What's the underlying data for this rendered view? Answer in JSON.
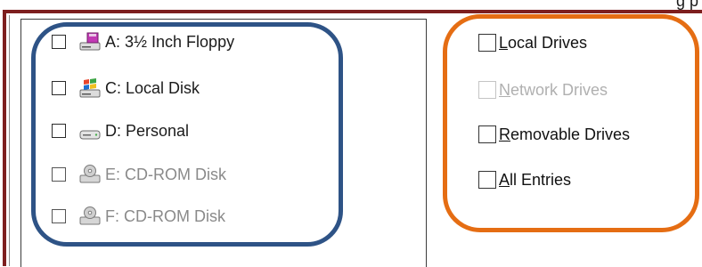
{
  "header": {
    "clipped_text": "g p"
  },
  "drive_list": {
    "items": [
      {
        "label": "A: 3½ Inch Floppy",
        "icon": "floppy-drive-icon",
        "checked": false,
        "enabled": true
      },
      {
        "label": "C: Local Disk",
        "icon": "windows-local-disk-icon",
        "checked": false,
        "enabled": true
      },
      {
        "label": "D: Personal",
        "icon": "hard-drive-icon",
        "checked": false,
        "enabled": true
      },
      {
        "label": "E: CD-ROM Disk",
        "icon": "cd-rom-drive-icon",
        "checked": false,
        "enabled": false
      },
      {
        "label": "F: CD-ROM Disk",
        "icon": "cd-rom-drive-icon",
        "checked": false,
        "enabled": false
      }
    ]
  },
  "options": {
    "local_drives": {
      "mnemonic": "L",
      "rest": "ocal Drives",
      "checked": false,
      "enabled": true
    },
    "network_drives": {
      "mnemonic": "N",
      "rest": "etwork Drives",
      "checked": false,
      "enabled": false
    },
    "removable_drives": {
      "mnemonic": "R",
      "rest": "emovable Drives",
      "checked": false,
      "enabled": true
    },
    "all_entries": {
      "mnemonic": "A",
      "rest": "ll Entries",
      "checked": false,
      "enabled": true
    }
  },
  "colors": {
    "frame": "#7d1f1f",
    "highlight_blue": "#2e5386",
    "highlight_orange": "#e56d13",
    "disabled_text": "#8a8a8a"
  }
}
